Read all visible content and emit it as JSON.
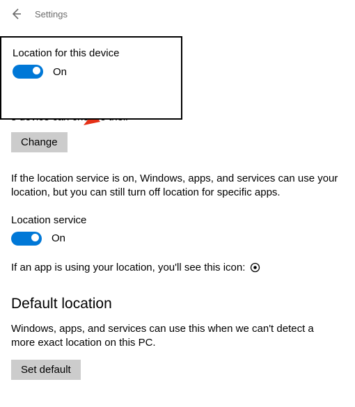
{
  "header": {
    "title": "Settings"
  },
  "callout": {
    "label": "Location for this device",
    "toggle_state": "On"
  },
  "page": {
    "intro_fragment": "s device can choose their",
    "change_button": "Change",
    "service_paragraph": "If the location service is on, Windows, apps, and services can use your location, but you can still turn off location for specific apps.",
    "service_label": "Location service",
    "service_toggle_state": "On",
    "app_using_text": "If an app is using your location, you'll see this icon:",
    "default_title": "Default location",
    "default_paragraph": "Windows, apps, and services can use this when we can't detect a more exact location on this PC.",
    "set_default_button": "Set default"
  }
}
